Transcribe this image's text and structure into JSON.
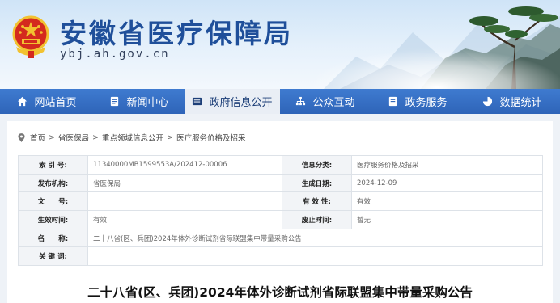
{
  "site": {
    "title": "安徽省医疗保障局",
    "domain": "ybj.ah.gov.cn"
  },
  "nav": [
    {
      "label": "网站首页",
      "icon": "home-icon"
    },
    {
      "label": "新闻中心",
      "icon": "news-icon"
    },
    {
      "label": "政府信息公开",
      "icon": "info-disclosure-icon",
      "active": true
    },
    {
      "label": "公众互动",
      "icon": "interaction-icon"
    },
    {
      "label": "政务服务",
      "icon": "service-icon"
    },
    {
      "label": "数据统计",
      "icon": "chart-icon"
    }
  ],
  "breadcrumb": [
    "首页",
    "省医保局",
    "重点领域信息公开",
    "医疗服务价格及招采"
  ],
  "meta": {
    "index_label": "索 引 号:",
    "index_value": "11340000MB1599553A/202412-00006",
    "category_label": "信息分类:",
    "category_value": "医疗服务价格及招采",
    "publisher_label": "发布机构:",
    "publisher_value": "省医保局",
    "date_label": "生成日期:",
    "date_value": "2024-12-09",
    "docno_label": "文　　号:",
    "docno_value": "",
    "validity_label": "有 效 性:",
    "validity_value": "有效",
    "effective_label": "生效时间:",
    "effective_value": "有效",
    "expire_label": "废止时间:",
    "expire_value": "暂无",
    "name_label": "名　　称:",
    "name_value": "二十八省(区、兵团)2024年体外诊断试剂省际联盟集中带量采购公告",
    "keywords_label": "关 键 词:",
    "keywords_value": ""
  },
  "document": {
    "title": "二十八省(区、兵团)2024年体外诊断试剂省际联盟集中带量采购公告"
  },
  "colors": {
    "nav_bg": "#3f7bd0",
    "title_blue": "#1f4f9a",
    "emblem_red": "#d42a1e",
    "emblem_gold": "#f2c230"
  }
}
